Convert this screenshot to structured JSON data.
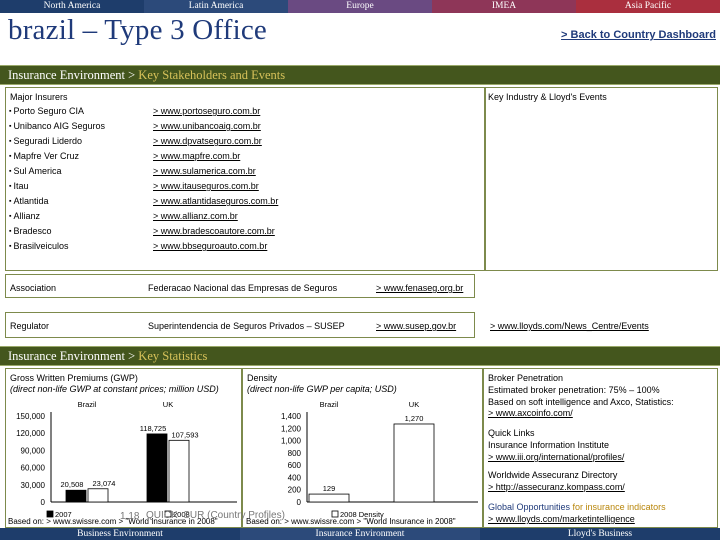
{
  "regions": [
    "North America",
    "Latin America",
    "Europe",
    "IMEA",
    "Asia Pacific"
  ],
  "page_title": "brazil – Type 3 Office",
  "back_link": "> Back to Country Dashboard",
  "section1": {
    "title": "Insurance Environment",
    "sep": " > ",
    "sub": "Key Stakeholders and Events"
  },
  "stakeholders": {
    "major_insurers_heading": "Major Insurers",
    "events_heading": "Key Industry & Lloyd's Events",
    "insurers": [
      {
        "name": "Porto Seguro CIA",
        "url": "> www.portoseguro.com.br"
      },
      {
        "name": "Unibanco AIG  Seguros",
        "url": "> www.unibancoaig.com.br"
      },
      {
        "name": "Seguradi Liderdo",
        "url": "> www.dpvatseguro.com.br"
      },
      {
        "name": "Mapfre Ver Cruz",
        "url": "> www.mapfre.com.br"
      },
      {
        "name": "Sul America",
        "url": "> www.sulamerica.com.br"
      },
      {
        "name": "Itau",
        "url": "> www.itauseguros.com.br"
      },
      {
        "name": "Atlantida",
        "url": "> www.atlantidaseguros.com.br"
      },
      {
        "name": "Allianz",
        "url": "> www.allianz.com.br"
      },
      {
        "name": "Bradesco",
        "url": "> www.bradescoautore.com.br"
      },
      {
        "name": "Brasilveiculos",
        "url": "> www.bbseguroauto.com.br"
      }
    ],
    "association": {
      "label": "Association",
      "name": "Federacao Nacional das Empresas de Seguros",
      "url": "> www.fenaseg.org.br"
    },
    "regulator": {
      "label": "Regulator",
      "name": "Superintendencia de Seguros Privados – SUSEP",
      "url": "> www.susep.gov.br"
    },
    "events_link": "> www.lloyds.com/News_Centre/Events"
  },
  "section2": {
    "title": "Insurance Environment",
    "sep": " > ",
    "sub": "Key Statistics"
  },
  "gwp": {
    "title": "Gross Written Premiums (GWP)",
    "subtitle": "(direct non-life GWP at constant prices; million USD)",
    "source": "Based on: > www.swissre.com > \"World Insurance in 2008\""
  },
  "density": {
    "title": "Density",
    "subtitle": "(direct non-life GWP per capita; USD)",
    "source": "Based on: > www.swissre.com > \"World Insurance in 2008\""
  },
  "chart_data": [
    {
      "type": "bar",
      "title": "Gross Written Premiums (GWP)",
      "series_labels": [
        "Brazil",
        "UK"
      ],
      "categories": [
        "Brazil",
        "UK"
      ],
      "series": [
        {
          "name": "2007",
          "values": [
            20508,
            118725
          ]
        },
        {
          "name": "2008",
          "values": [
            23074,
            107593
          ]
        }
      ],
      "value_labels": [
        [
          "20,508",
          "118,725"
        ],
        [
          "23,074",
          "107,593"
        ]
      ],
      "yticks": [
        "0",
        "30,000",
        "60,000",
        "90,000",
        "120,000",
        "150,000"
      ],
      "ylim": [
        0,
        150000
      ],
      "legend": [
        "2007",
        "2008"
      ]
    },
    {
      "type": "bar",
      "title": "Density",
      "series_labels": [
        "Brazil",
        "UK"
      ],
      "categories": [
        "Brazil",
        "UK"
      ],
      "series": [
        {
          "name": "2008",
          "values": [
            129,
            1270
          ]
        }
      ],
      "value_labels": [
        [
          "129",
          "1,270"
        ]
      ],
      "yticks": [
        "0",
        "200",
        "400",
        "600",
        "800",
        "1,000",
        "1,200",
        "1,400"
      ],
      "ylim": [
        0,
        1400
      ],
      "legend": [
        "2008 Density"
      ]
    }
  ],
  "broker": {
    "title": "Broker Penetration",
    "text1": "Estimated broker penetration: 75% – 100%",
    "text2": "Based on soft intelligence and Axco, Statistics:",
    "link": "> www.axcoinfo.com/"
  },
  "quick_links": {
    "title": "Quick Links",
    "text": "Insurance Information Institute",
    "link": "> www.iii.org/international/profiles/"
  },
  "worldwide": {
    "title": "Worldwide Assecuranz Directory",
    "link": "> http://assecuranz.kompass.com/"
  },
  "global_opps": {
    "text1": "Global Opportunities",
    "text2": " for insurance indicators",
    "link": "> www.lloyds.com/marketintelligence"
  },
  "overlay_text": "QUICK_SUR (Country Profiles)",
  "page_number": "1.18",
  "bottom_tabs": [
    "Business Environment",
    "Insurance Environment",
    "Lloyd's Business"
  ],
  "colors": {
    "navy": "#1f3a7a",
    "olive": "#44561d",
    "gold": "#d7c25a",
    "bar_dark": "#000000",
    "bar_light": "#ffffff"
  }
}
